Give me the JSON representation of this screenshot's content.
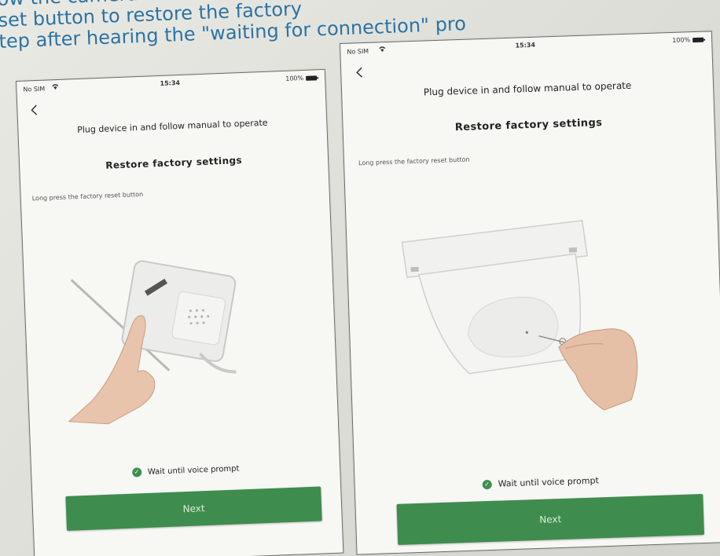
{
  "page_header": {
    "line1": "ow the camera",
    "line2": "set button to restore the factory",
    "line3": "tep after hearing the \"waiting for connection\" pro"
  },
  "status_bar": {
    "carrier": "No SIM",
    "wifi_icon": "wifi-icon",
    "time_left": "15:34",
    "time_right": "15:34",
    "battery": "100%"
  },
  "screen": {
    "back_icon": "chevron-left-icon",
    "instruction": "Plug device in and follow manual to operate",
    "title": "Restore factory settings",
    "hint": "Long press the factory reset button",
    "prompt_icon": "check-circle-icon",
    "prompt": "Wait until voice prompt",
    "next_label": "Next"
  },
  "colors": {
    "accent_green": "#3f8c4f",
    "header_blue": "#2c73a3"
  }
}
